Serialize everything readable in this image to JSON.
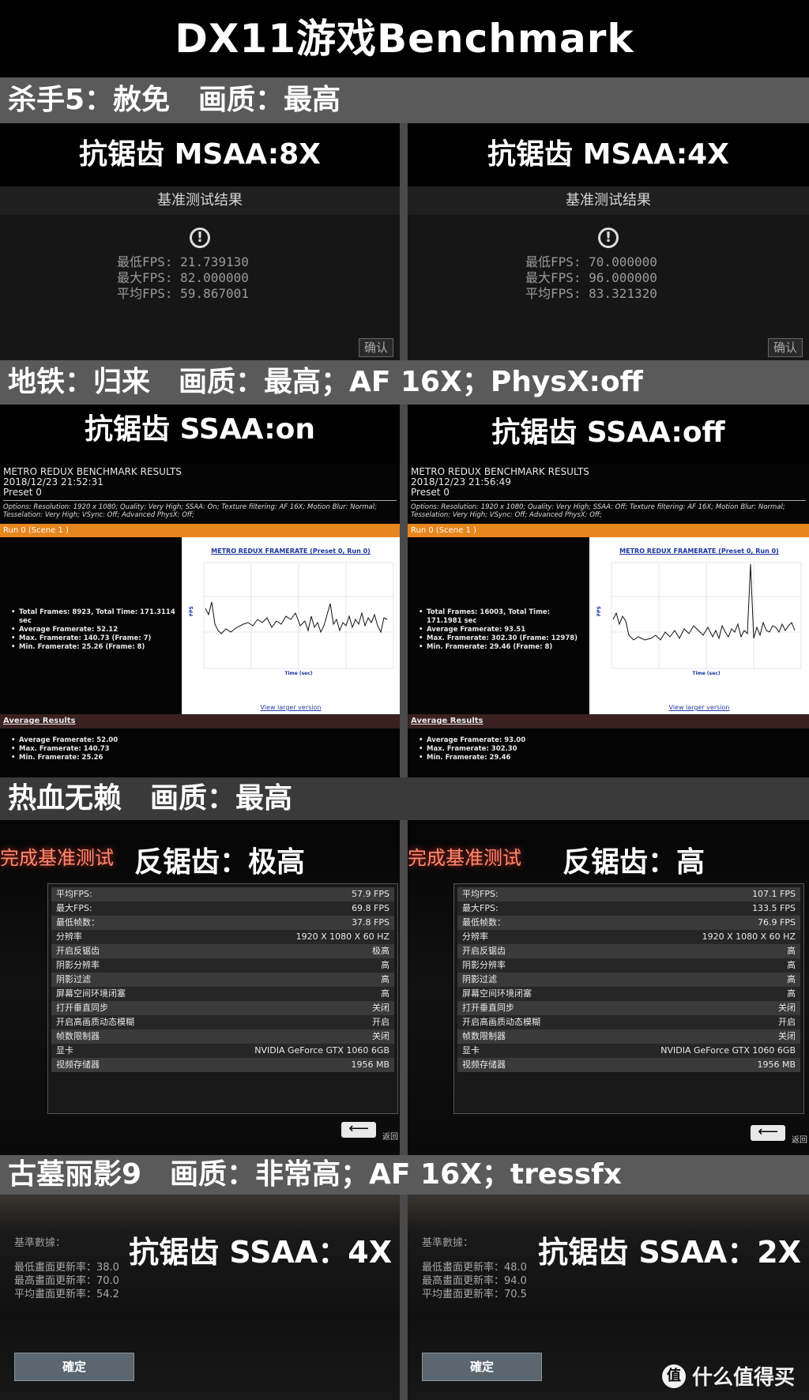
{
  "page_title": "DX11游戏Benchmark",
  "hitman": {
    "section": "杀手5：赦免　画质：最高",
    "panels": [
      {
        "aa": "抗锯齿 MSAA:8X",
        "dialog_title": "基准测试结果",
        "min": "最低FPS: 21.739130",
        "max": "最大FPS: 82.000000",
        "avg": "平均FPS: 59.867001",
        "ok": "确认"
      },
      {
        "aa": "抗锯齿 MSAA:4X",
        "dialog_title": "基准测试结果",
        "min": "最低FPS: 70.000000",
        "max": "最大FPS: 96.000000",
        "avg": "平均FPS: 83.321320",
        "ok": "确认"
      }
    ]
  },
  "metro": {
    "section": "地铁：归来　画质：最高；AF 16X；PhysX:off",
    "panels": [
      {
        "aa": "抗锯齿 SSAA:on",
        "hdr1": "METRO REDUX BENCHMARK RESULTS",
        "hdr2": "2018/12/23 21:52:31",
        "hdr3": "Preset 0",
        "options": "Options: Resolution: 1920 x 1080; Quality: Very High; SSAA: On; Texture filtering: AF 16X; Motion Blur: Normal; Tesselation: Very High; VSync: Off; Advanced PhysX: Off;",
        "run": "Run 0 (Scene 1 )",
        "stats": [
          "Total Frames: 8923, Total Time: 171.3114 sec",
          "Average Framerate: 52.12",
          "Max. Framerate: 140.73 (Frame: 7)",
          "Min. Framerate: 25.26 (Frame: 8)"
        ],
        "chart_title": "METRO REDUX FRAMERATE (Preset 0, Run 0)",
        "link": "View larger version",
        "avg_title": "Average Results",
        "avg": [
          "Average Framerate: 52.00",
          "Max. Framerate: 140.73",
          "Min. Framerate: 25.26"
        ]
      },
      {
        "aa": "抗锯齿 SSAA:off",
        "hdr1": "METRO REDUX BENCHMARK RESULTS",
        "hdr2": "2018/12/23 21:56:49",
        "hdr3": "Preset 0",
        "options": "Options: Resolution: 1920 x 1080; Quality: Very High; SSAA: Off; Texture filtering: AF 16X; Motion Blur: Normal; Tesselation: Very High; VSync: Off; Advanced PhysX: Off;",
        "run": "Run 0 (Scene 1 )",
        "stats": [
          "Total Frames: 16003, Total Time: 171.1981 sec",
          "Average Framerate: 93.51",
          "Max. Framerate: 302.30 (Frame: 12978)",
          "Min. Framerate: 29.46 (Frame: 8)"
        ],
        "chart_title": "METRO REDUX FRAMERATE (Preset 0, Run 0)",
        "link": "View larger version",
        "avg_title": "Average Results",
        "avg": [
          "Average Framerate: 93.00",
          "Max. Framerate: 302.30",
          "Min. Framerate: 29.46"
        ]
      }
    ]
  },
  "sleeping_dogs": {
    "section": "热血无赖　画质：最高",
    "panels": [
      {
        "done": "完成基准测试",
        "aa": "反锯齿：极高",
        "rows": [
          [
            "平均FPS:",
            "57.9 FPS"
          ],
          [
            "最大FPS:",
            "69.8 FPS"
          ],
          [
            "最低帧数：",
            "37.8 FPS"
          ],
          [
            "分辨率",
            "1920 X 1080 X 60 HZ"
          ],
          [
            "开启反锯齿",
            "极高"
          ],
          [
            "阴影分辨率",
            "高"
          ],
          [
            "阴影过滤",
            "高"
          ],
          [
            "屏幕空间环境闭塞",
            "高"
          ],
          [
            "打开垂直同步",
            "关闭"
          ],
          [
            "开启高画质动态模糊",
            "开启"
          ],
          [
            "帧数限制器",
            "关闭"
          ],
          [
            "显卡",
            "NVIDIA GeForce GTX 1060 6GB"
          ],
          [
            "视频存储器",
            "1956 MB"
          ]
        ],
        "back": "返回"
      },
      {
        "done": "完成基准测试",
        "aa": "反锯齿：高",
        "rows": [
          [
            "平均FPS:",
            "107.1 FPS"
          ],
          [
            "最大FPS:",
            "133.5 FPS"
          ],
          [
            "最低帧数：",
            "76.9 FPS"
          ],
          [
            "分辨率",
            "1920 X 1080 X 60 HZ"
          ],
          [
            "开启反锯齿",
            "高"
          ],
          [
            "阴影分辨率",
            "高"
          ],
          [
            "阴影过滤",
            "高"
          ],
          [
            "屏幕空间环境闭塞",
            "高"
          ],
          [
            "打开垂直同步",
            "关闭"
          ],
          [
            "开启高画质动态模糊",
            "开启"
          ],
          [
            "帧数限制器",
            "关闭"
          ],
          [
            "显卡",
            "NVIDIA GeForce GTX 1060 6GB"
          ],
          [
            "视频存储器",
            "1956 MB"
          ]
        ],
        "back": "返回"
      }
    ]
  },
  "tomb_raider": {
    "section": "古墓丽影9　画质：非常高；AF 16X；tressfx",
    "panels": [
      {
        "label": "基準數據：",
        "min": "最低畫面更新率：38.0",
        "max": "最高畫面更新率：70.0",
        "avg": "平均畫面更新率：54.2",
        "aa": "抗锯齿 SSAA：4X",
        "ok": "確定"
      },
      {
        "label": "基準數據：",
        "min": "最低畫面更新率：48.0",
        "max": "最高畫面更新率：94.0",
        "avg": "平均畫面更新率：70.5",
        "aa": "抗锯齿 SSAA：2X",
        "ok": "確定"
      }
    ]
  },
  "watermark": "值 什么值得买"
}
